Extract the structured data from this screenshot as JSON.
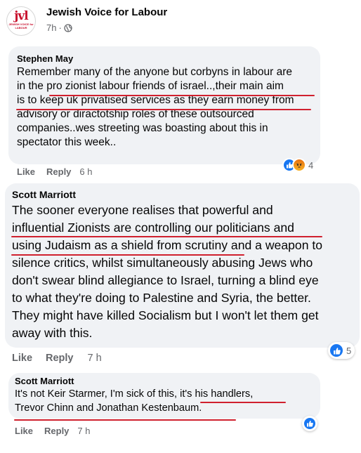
{
  "post": {
    "page_name": "Jewish Voice for Labour",
    "logo": {
      "text": "jvl",
      "subtext": "JEWISH VOICE for LABOUR"
    },
    "time": "7h",
    "audience_icon": "globe-icon"
  },
  "comments": [
    {
      "author": "Stephen May",
      "lines": [
        "Remember many of the anyone but corbyns in labour are",
        "in the pro zionist labour friends of israel..,their main aim",
        "is to keep uk privatised services as they earn money from",
        "advisory or diractotship roles of these outsourced",
        "companies..wes streeting was boasting about this in",
        "spectator this week.."
      ],
      "like_label": "Like",
      "reply_label": "Reply",
      "time": "6 h",
      "reaction_icons": [
        "like-icon",
        "angry-icon"
      ],
      "reaction_count": "4"
    },
    {
      "author": "Scott Marriott",
      "lines": [
        "The sooner everyone realises that powerful and",
        "influential Zionists are controlling our politicians and",
        "using Judaism as a shield from scrutiny and a weapon to",
        "silence critics, whilst simultaneously abusing Jews who",
        "don't swear blind allegiance to Israel, turning a blind eye",
        "to what they're doing to Palestine and Syria, the better.",
        "They might have killed Socialism but I won't let them get",
        "away with this."
      ],
      "like_label": "Like",
      "reply_label": "Reply",
      "time": "7 h",
      "reaction_icons": [
        "like-icon"
      ],
      "reaction_count": "5"
    },
    {
      "author": "Scott Marriott",
      "lines": [
        "It's not Keir Starmer, I'm sick of this, it's his handlers,",
        "Trevor Chinn and Jonathan Kestenbaum."
      ],
      "like_label": "Like",
      "reply_label": "Reply",
      "time": "7 h",
      "reaction_icons": [
        "like-icon"
      ]
    }
  ],
  "colors": {
    "bubble": "#f0f2f5",
    "meta_text": "#65676b",
    "like_blue": "#1877f2",
    "annotation_red": "#d0202e"
  }
}
